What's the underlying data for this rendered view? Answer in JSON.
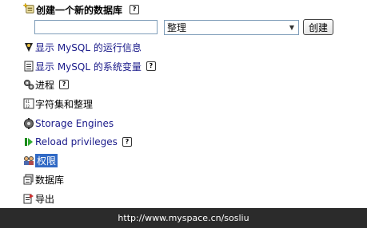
{
  "create_db": {
    "title": "创建一个新的数据库",
    "help_label": "?",
    "db_name_value": "",
    "collation_selected": "整理",
    "create_button": "创建"
  },
  "menu": [
    {
      "label": "显示 MySQL 的运行信息",
      "icon": "server-status-icon",
      "help": false
    },
    {
      "label": "显示 MySQL 的系统变量",
      "icon": "variables-icon",
      "help": true
    },
    {
      "label": "进程",
      "icon": "process-icon",
      "help": true
    },
    {
      "label": "字符集和整理",
      "icon": "charset-icon",
      "help": false
    },
    {
      "label": "Storage Engines",
      "icon": "storage-engines-icon",
      "help": false
    },
    {
      "label": "Reload privileges",
      "icon": "reload-icon",
      "help": true
    },
    {
      "label": "权限",
      "icon": "privileges-icon",
      "help": false
    },
    {
      "label": "数据库",
      "icon": "databases-icon",
      "help": false
    },
    {
      "label": "导出",
      "icon": "export-icon",
      "help": false
    }
  ],
  "footer": {
    "watermark": "http://www.myspace.cn/sosliu"
  }
}
